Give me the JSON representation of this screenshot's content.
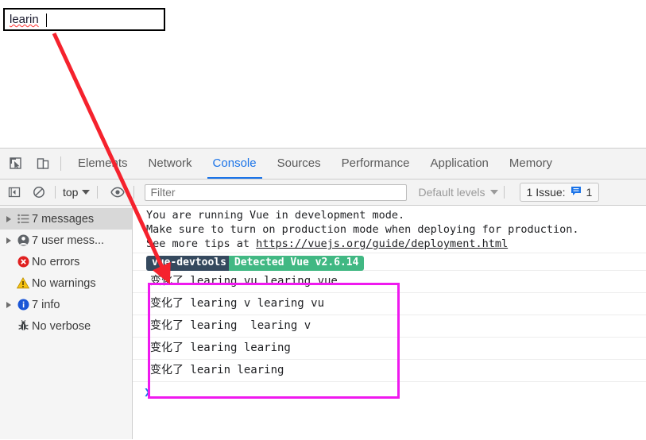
{
  "page": {
    "input": {
      "value": "learin",
      "spellcheck_underline": true
    }
  },
  "devtools": {
    "tabs": [
      {
        "label": "Elements",
        "active": false
      },
      {
        "label": "Network",
        "active": false
      },
      {
        "label": "Console",
        "active": true
      },
      {
        "label": "Sources",
        "active": false
      },
      {
        "label": "Performance",
        "active": false
      },
      {
        "label": "Application",
        "active": false
      },
      {
        "label": "Memory",
        "active": false
      }
    ],
    "toolbar_icons": [
      "inspect-icon",
      "device-toolbar-icon"
    ],
    "filterbar": {
      "sidebar_toggle_icon": "sidebar-toggle-icon",
      "clear_console_icon": "clear-console-icon",
      "context_label": "top",
      "eye_icon": "live-expression-eye-icon",
      "filter_placeholder": "Filter",
      "filter_value": "",
      "levels_label": "Default levels",
      "issues_label": "1 Issue:",
      "issues_count": "1"
    },
    "sidebar": [
      {
        "label": "7 messages",
        "icon": "list-icon",
        "expandable": true,
        "selected": true
      },
      {
        "label": "7 user mess...",
        "icon": "user-icon",
        "expandable": true,
        "selected": false
      },
      {
        "label": "No errors",
        "icon": "error-icon",
        "expandable": false,
        "selected": false
      },
      {
        "label": "No warnings",
        "icon": "warning-icon",
        "expandable": false,
        "selected": false
      },
      {
        "label": "7 info",
        "icon": "info-icon",
        "expandable": true,
        "selected": false
      },
      {
        "label": "No verbose",
        "icon": "verbose-bug-icon",
        "expandable": false,
        "selected": false
      }
    ],
    "console": {
      "vue_message_line1": "You are running Vue in development mode.",
      "vue_message_line2": "Make sure to turn on production mode when deploying for production.",
      "vue_message_line3_prefix": "See more tips at ",
      "vue_message_link": "https://vuejs.org/guide/deployment.html",
      "devtools_badge_left": "vue-devtools",
      "devtools_badge_right": "Detected Vue v2.6.14",
      "badge_left_color": "#35495e",
      "badge_right_color": "#41b883",
      "logs": [
        "变化了 learing vu learing vue",
        "变化了 learing v learing vu",
        "变化了 learing  learing v",
        "变化了 learing learing",
        "变化了 learin learing"
      ],
      "prompt_symbol": "❯"
    }
  },
  "annotations": {
    "box_color": "#ef19ef",
    "arrow_color": "#f5222d"
  }
}
